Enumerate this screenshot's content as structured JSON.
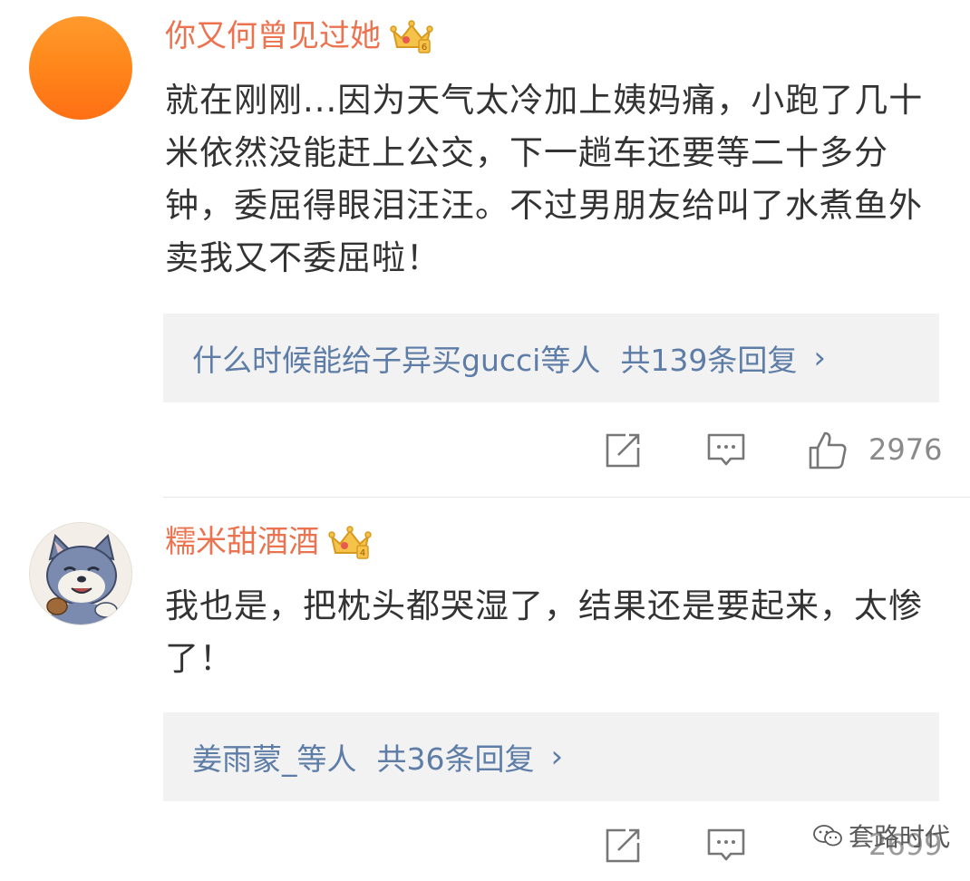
{
  "comments": [
    {
      "username": "你又何曾见过她",
      "text": "就在刚刚...因为天气太冷加上姨妈痛，小跑了几十米依然没能赶上公交，下一趟车还要等二十多分钟，委屈得眼泪汪汪。不过男朋友给叫了水煮鱼外卖我又不委屈啦！",
      "reply_users": "什么时候能给子异买gucci等人",
      "reply_total": "共139条回复",
      "reply_chevron": "›",
      "like_count": "2976",
      "avatar": "orange-avatar",
      "badge": "crown-badge"
    },
    {
      "username": "糯米甜酒酒",
      "text": "我也是，把枕头都哭湿了，结果还是要起来，太惨了！",
      "reply_users": "姜雨蒙_等人",
      "reply_total": "共36条回复",
      "reply_chevron": "›",
      "like_count": "2699",
      "avatar": "cartoon-cat-avatar",
      "badge": "crown-badge"
    }
  ],
  "watermark": {
    "text": "套路时代",
    "icon": "wechat-icon"
  },
  "colors": {
    "username": "#eb7350",
    "link": "#5d7ca6",
    "text": "#333333",
    "muted": "#8a8a8a",
    "reply_bg": "#f2f2f2",
    "crown": "#f0b63a"
  }
}
